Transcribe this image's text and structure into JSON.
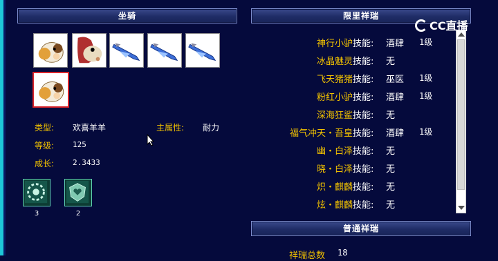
{
  "panels": {
    "mount_title": "坐骑",
    "limited_title": "限里祥瑞",
    "normal_title": "普通祥瑞"
  },
  "mount_slots": [
    {
      "icon": "sheep-mount-icon"
    },
    {
      "icon": "horse-mount-icon"
    },
    {
      "icon": "blue-jet-icon"
    },
    {
      "icon": "blue-jet-icon"
    },
    {
      "icon": "blue-jet-icon"
    },
    {
      "icon": "sheep-mount-icon",
      "selected": true
    }
  ],
  "mount_info": {
    "type_label": "类型:",
    "type_value": "欢喜羊羊",
    "attr_label": "主属性:",
    "attr_value": "耐力",
    "level_label": "等级:",
    "level_value": "125",
    "growth_label": "成长:",
    "growth_value": "2.3433"
  },
  "skills": [
    {
      "icon": "gear-skill-icon",
      "count": "3"
    },
    {
      "icon": "heart-shield-skill-icon",
      "count": "2"
    }
  ],
  "limited_list": [
    {
      "name": "神行小驴",
      "skill": "技能:",
      "value": "酒肆",
      "level": "1级"
    },
    {
      "name": "冰晶魅灵",
      "skill": "技能:",
      "value": "无",
      "level": ""
    },
    {
      "name": "飞天猪猪",
      "skill": "技能:",
      "value": "巫医",
      "level": "1级"
    },
    {
      "name": "粉红小驴",
      "skill": "技能:",
      "value": "酒肆",
      "level": "1级"
    },
    {
      "name": "深海狂鲨",
      "skill": "技能:",
      "value": "无",
      "level": ""
    },
    {
      "name": "福气冲天・吾皇",
      "skill": "技能:",
      "value": "酒肆",
      "level": "1级"
    },
    {
      "name": "幽・白泽",
      "skill": "技能:",
      "value": "无",
      "level": ""
    },
    {
      "name": "晓・白泽",
      "skill": "技能:",
      "value": "无",
      "level": ""
    },
    {
      "name": "炽・麒麟",
      "skill": "技能:",
      "value": "无",
      "level": ""
    },
    {
      "name": "炫・麒麟",
      "skill": "技能:",
      "value": "无",
      "level": ""
    }
  ],
  "normal": {
    "total_label": "祥瑞总数",
    "total_value": "18"
  },
  "watermark": {
    "text": "CC直播"
  }
}
